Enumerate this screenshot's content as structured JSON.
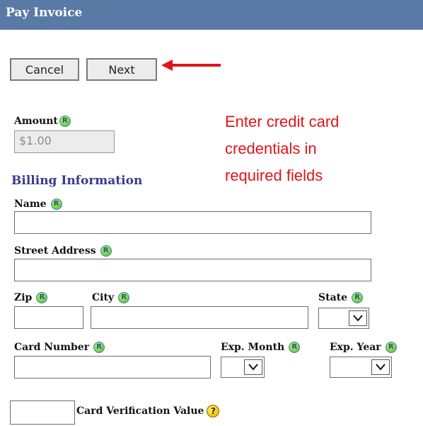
{
  "header": {
    "title": "Pay Invoice"
  },
  "buttons": {
    "cancel": "Cancel",
    "next": "Next"
  },
  "callout": {
    "lines": [
      "Enter credit card",
      "credentials in",
      "required fields"
    ],
    "color": "#e0141a"
  },
  "amount": {
    "label": "Amount",
    "value": "$1.00"
  },
  "billing": {
    "heading": "Billing Information",
    "name_label": "Name",
    "street_label": "Street Address",
    "zip_label": "Zip",
    "city_label": "City",
    "state_label": "State",
    "card_number_label": "Card Number",
    "exp_month_label": "Exp. Month",
    "exp_year_label": "Exp. Year",
    "cvv_label": "Card Verification Value"
  },
  "icons": {
    "required": "R",
    "help": "?"
  },
  "colors": {
    "header_bg": "#5a7aa6",
    "section_heading": "#3b3a8c"
  }
}
